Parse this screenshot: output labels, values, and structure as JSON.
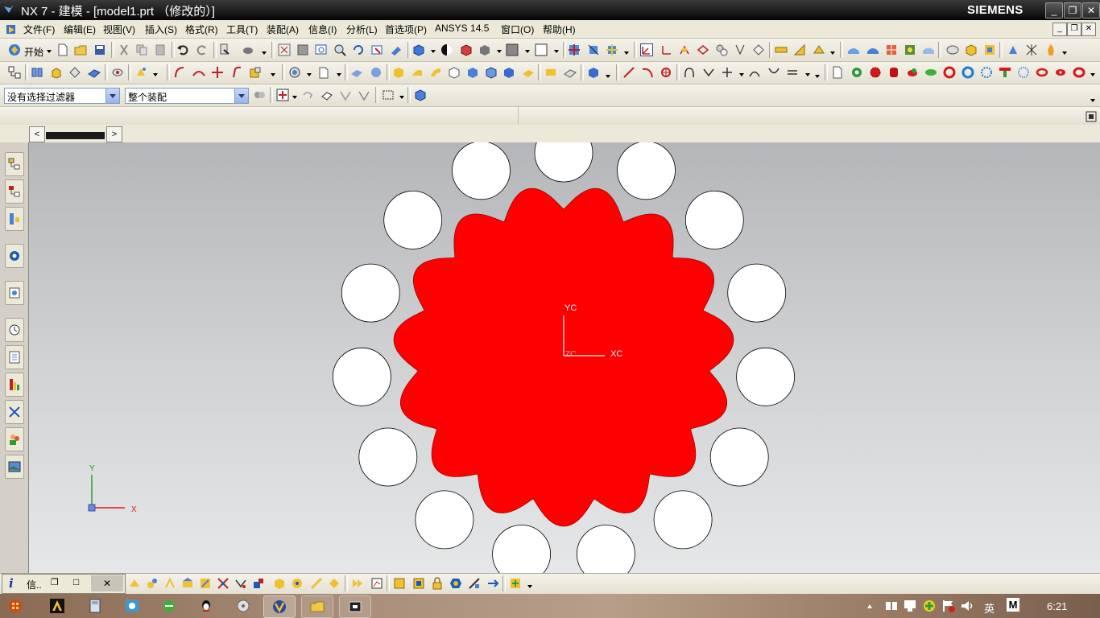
{
  "window": {
    "title": "NX 7 - 建模 - [model1.prt （修改的）]",
    "brand": "SIEMENS",
    "min_label": "_",
    "max_label": "❐",
    "close_label": "✕"
  },
  "menubar": {
    "items": [
      "文件(F)",
      "编辑(E)",
      "视图(V)",
      "插入(S)",
      "格式(R)",
      "工具(T)",
      "装配(A)",
      "信息(I)",
      "分析(L)",
      "首选项(P)",
      "ANSYS 14.5",
      "窗口(O)",
      "帮助(H)"
    ],
    "mdi_min": "_",
    "mdi_restore": "❐",
    "mdi_close": "✕"
  },
  "toolbar": {
    "start_label": "开始",
    "selection_filter": "没有选择过滤器",
    "selection_scope": "整个装配"
  },
  "tabstrip": {
    "left_arrow": "<",
    "right_arrow": ">"
  },
  "graphics": {
    "wcs_x_label": "XC",
    "wcs_y_label": "YC",
    "wcs_z_label": "ZC",
    "triad_x_label": "X",
    "triad_y_label": "Y",
    "part_color": "#ff0000",
    "roller_color": "#ffffff"
  },
  "infotab": {
    "label": "信..",
    "restore": "❐",
    "maximize": "□",
    "close": "✕"
  },
  "taskbar": {
    "ime_label": "英",
    "m_label": "M",
    "clock": "6:21"
  }
}
